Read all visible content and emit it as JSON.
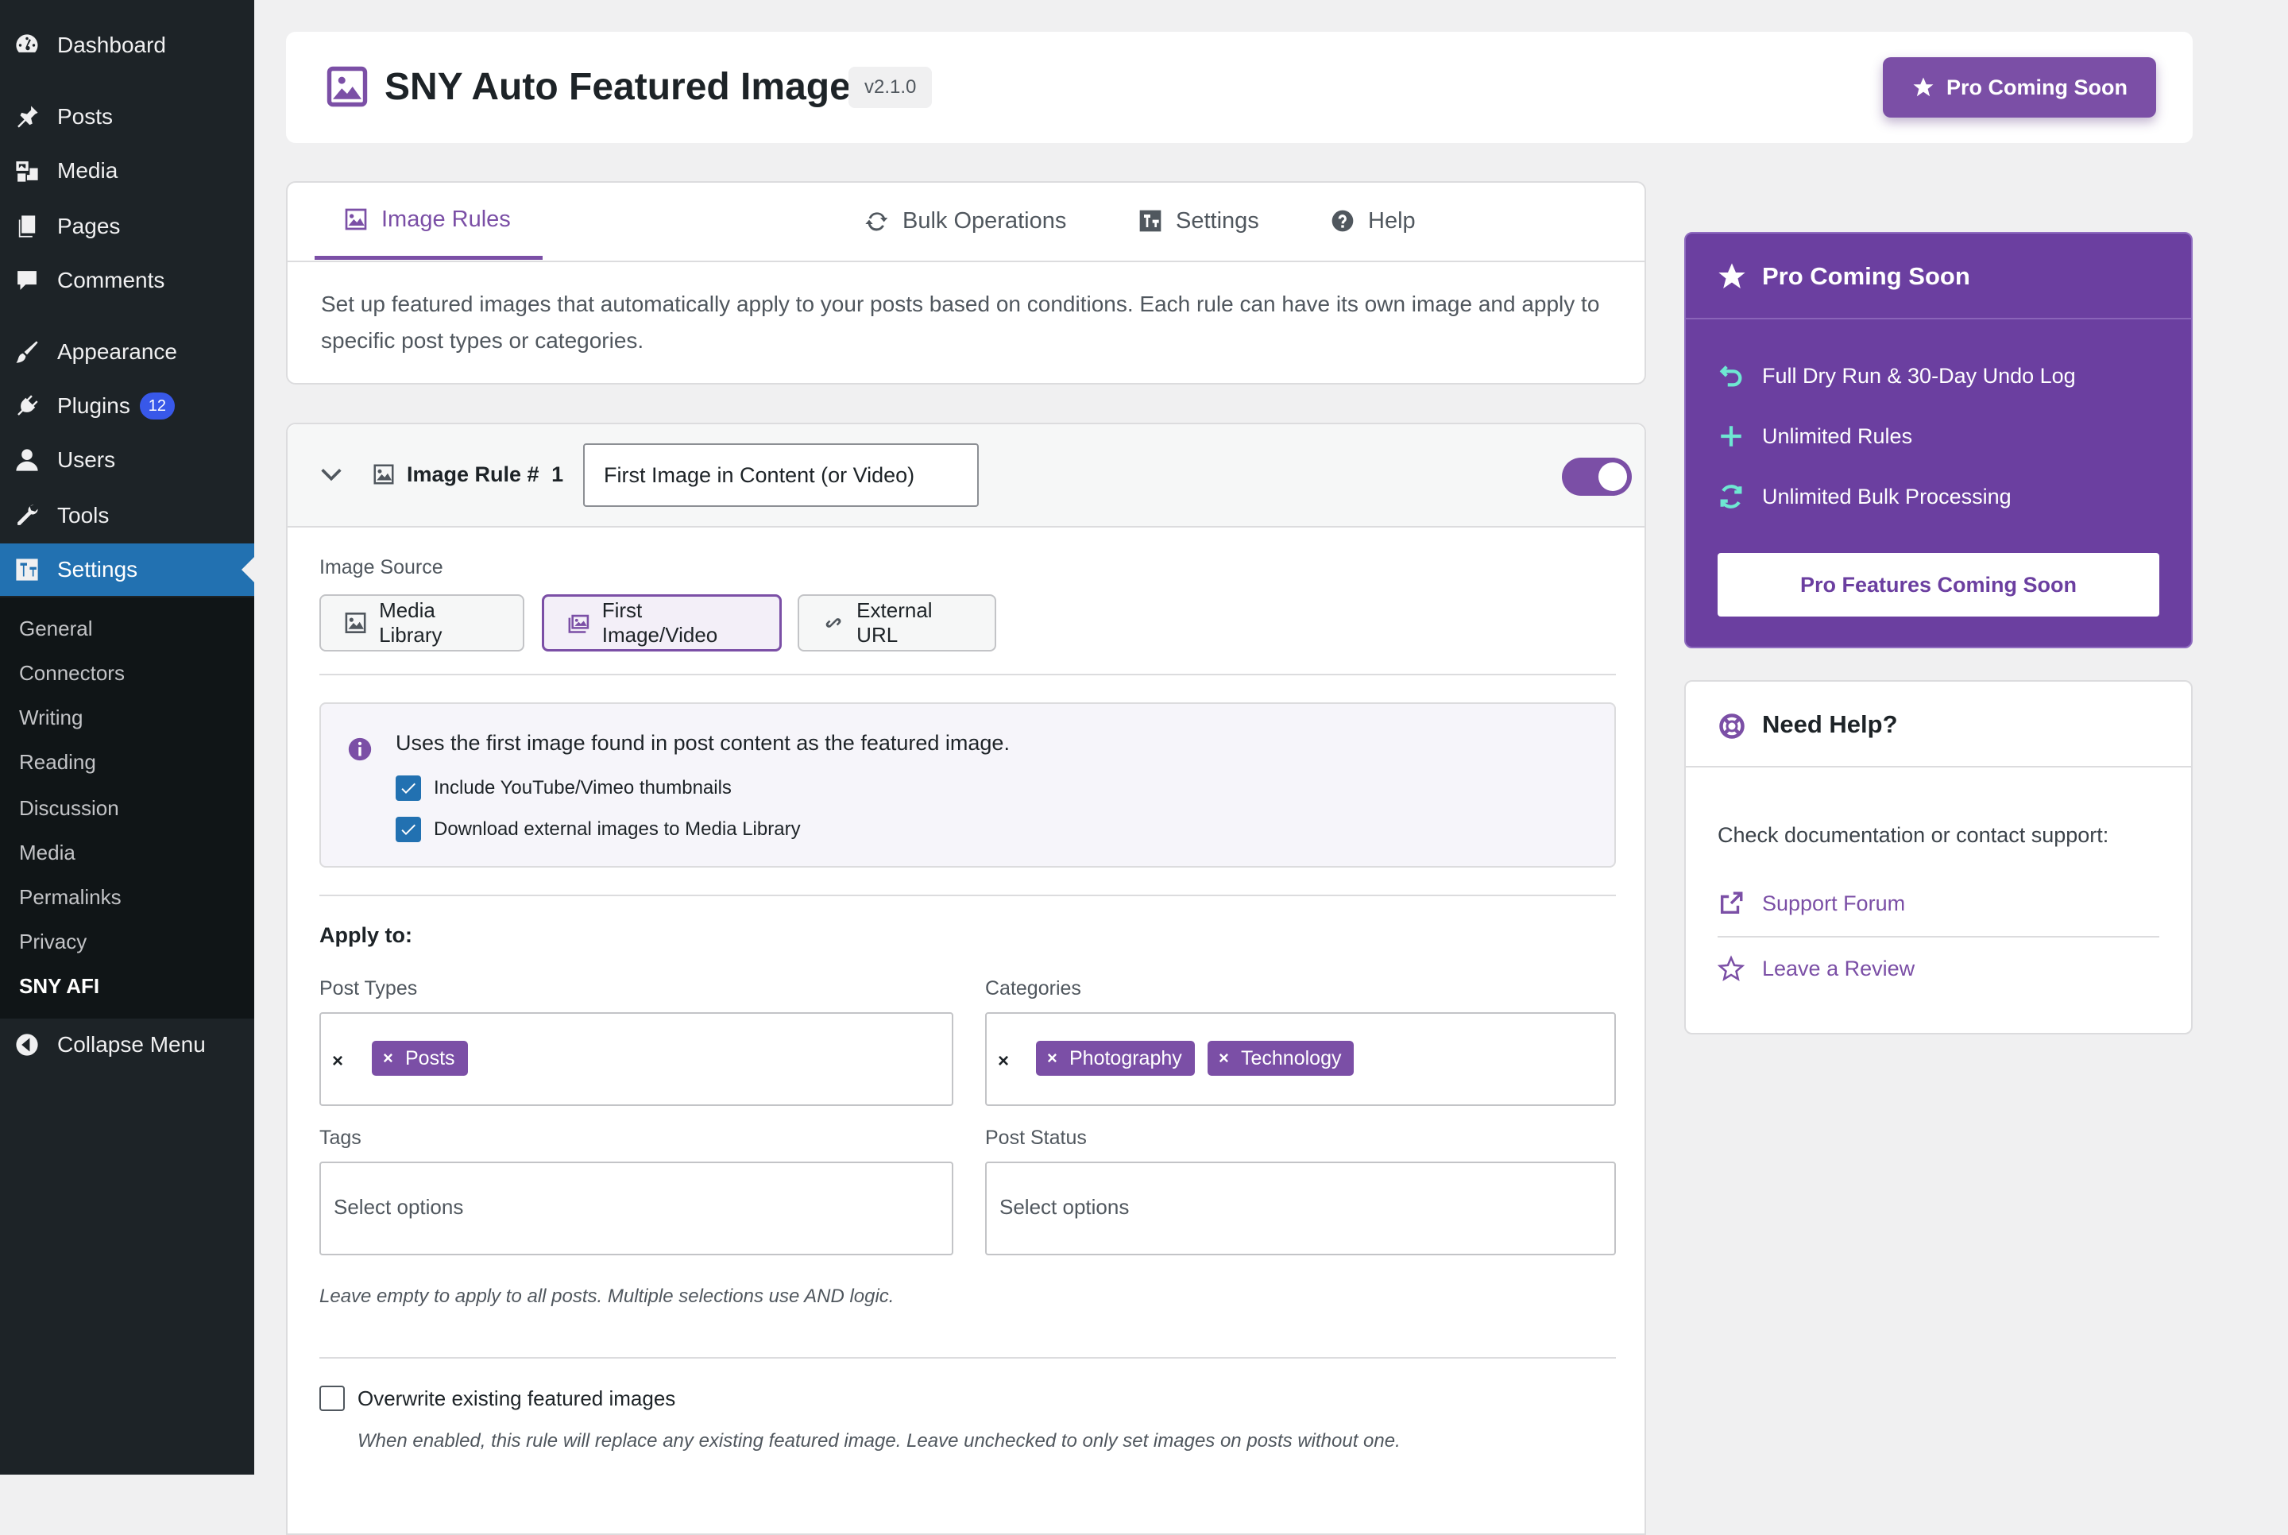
{
  "sidebar": {
    "items": [
      {
        "label": "Dashboard",
        "icon": "dashboard-icon"
      },
      {
        "label": "Posts",
        "icon": "pin-icon"
      },
      {
        "label": "Media",
        "icon": "media-icon"
      },
      {
        "label": "Pages",
        "icon": "pages-icon"
      },
      {
        "label": "Comments",
        "icon": "comments-icon"
      },
      {
        "label": "Appearance",
        "icon": "brush-icon"
      },
      {
        "label": "Plugins",
        "icon": "plugin-icon",
        "badge": "12"
      },
      {
        "label": "Users",
        "icon": "users-icon"
      },
      {
        "label": "Tools",
        "icon": "wrench-icon"
      },
      {
        "label": "Settings",
        "icon": "settings-icon"
      }
    ],
    "submenu": [
      "General",
      "Connectors",
      "Writing",
      "Reading",
      "Discussion",
      "Media",
      "Permalinks",
      "Privacy",
      "SNY AFI"
    ],
    "collapse_label": "Collapse Menu"
  },
  "header": {
    "title": "SNY Auto Featured Image",
    "version": "v2.1.0",
    "pro_button": "Pro Coming Soon"
  },
  "tabs": {
    "items": [
      "Image Rules",
      "Bulk Operations",
      "Settings",
      "Help"
    ],
    "active": "Image Rules",
    "description": "Set up featured images that automatically apply to your posts based on conditions. Each rule can have its own image and apply to specific post types or categories."
  },
  "rule": {
    "label": "Image Rule #",
    "number": "1",
    "name_value": "First Image in Content (or Video)",
    "enabled": true,
    "image_source_label": "Image Source",
    "sources": [
      "Media Library",
      "First Image/Video",
      "External URL"
    ],
    "active_source": "First Image/Video",
    "info_text": "Uses the first image found in post content as the featured image.",
    "options": [
      {
        "label": "Include YouTube/Vimeo thumbnails",
        "checked": true
      },
      {
        "label": "Download external images to Media Library",
        "checked": true
      }
    ],
    "apply_to_label": "Apply to:",
    "post_types_label": "Post Types",
    "post_types": [
      "Posts"
    ],
    "categories_label": "Categories",
    "categories": [
      "Photography",
      "Technology"
    ],
    "tags_label": "Tags",
    "tags_placeholder": "Select options",
    "post_status_label": "Post Status",
    "post_status_placeholder": "Select options",
    "clear_symbol": "×",
    "help_text": "Leave empty to apply to all posts. Multiple selections use AND logic.",
    "overwrite_label": "Overwrite existing featured images",
    "overwrite_checked": false,
    "overwrite_help": "When enabled, this rule will replace any existing featured image. Leave unchecked to only set images on posts without one."
  },
  "pro_panel": {
    "title": "Pro Coming Soon",
    "features": [
      {
        "label": "Full Dry Run & 30-Day Undo Log",
        "icon": "undo-icon"
      },
      {
        "label": "Unlimited Rules",
        "icon": "plus-icon"
      },
      {
        "label": "Unlimited Bulk Processing",
        "icon": "refresh-icon"
      }
    ],
    "button": "Pro Features Coming Soon"
  },
  "help_panel": {
    "title": "Need Help?",
    "description": "Check documentation or contact support:",
    "links": [
      {
        "label": "Support Forum",
        "icon": "external-link-icon"
      },
      {
        "label": "Leave a Review",
        "icon": "star-outline-icon"
      }
    ]
  },
  "colors": {
    "accent": "#7b4fa6",
    "admin_bar": "#1d2327",
    "wp_blue": "#2271b1"
  }
}
